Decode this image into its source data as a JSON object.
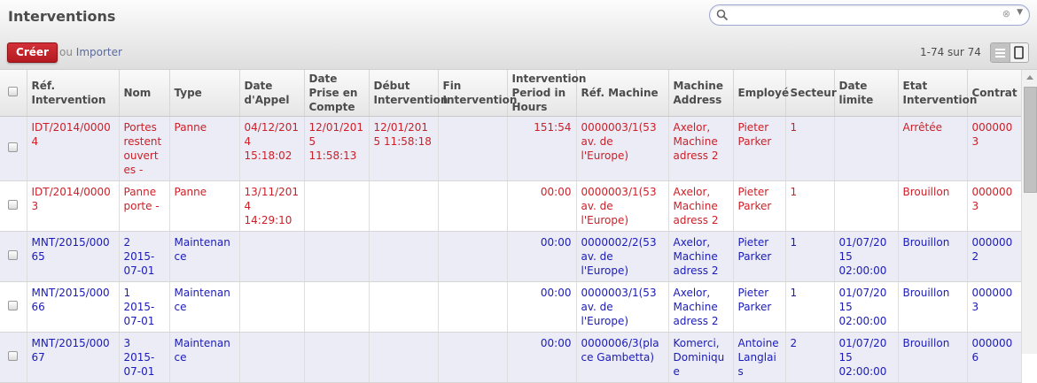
{
  "header": {
    "title": "Interventions",
    "search_placeholder": "",
    "search_clear": "⊗",
    "search_dropdown": "▼"
  },
  "toolbar": {
    "create_label": "Créer",
    "or_label": "ou",
    "import_label": "Importer",
    "pager": "1-74 sur 74"
  },
  "table": {
    "columns": [
      "Réf. Intervention",
      "Nom",
      "Type",
      "Date d'Appel",
      "Date Prise en Compte",
      "Début Intervention",
      "Fin Intervention",
      "Intervention Period in Hours",
      "Réf. Machine",
      "Machine Address",
      "Employé",
      "Secteur",
      "Date limite",
      "Etat Intervention",
      "Contrat"
    ],
    "rows": [
      {
        "color": "red",
        "cells": [
          "IDT/2014/00004",
          "Portes restent ouvertes -",
          "Panne",
          "04/12/2014 15:18:02",
          "12/01/2015 11:58:13",
          "12/01/2015 11:58:18",
          "",
          "151:54",
          "0000003/1(53 av. de l'Europe)",
          "Axelor, Machine adress 2",
          "Pieter Parker",
          "1",
          "",
          "Arrêtée",
          "0000003"
        ]
      },
      {
        "color": "red",
        "cells": [
          "IDT/2014/00003",
          "Panne porte -",
          "Panne",
          "13/11/2014 14:29:10",
          "",
          "",
          "",
          "00:00",
          "0000003/1(53 av. de l'Europe)",
          "Axelor, Machine adress 2",
          "Pieter Parker",
          "1",
          "",
          "Brouillon",
          "0000003"
        ]
      },
      {
        "color": "blue",
        "cells": [
          "MNT/2015/00065",
          "2 2015-07-01",
          "Maintenance",
          "",
          "",
          "",
          "",
          "00:00",
          "0000002/2(53 av. de l'Europe)",
          "Axelor, Machine adress 2",
          "Pieter Parker",
          "1",
          "01/07/2015 02:00:00",
          "Brouillon",
          "0000002"
        ]
      },
      {
        "color": "blue",
        "cells": [
          "MNT/2015/00066",
          "1 2015-07-01",
          "Maintenance",
          "",
          "",
          "",
          "",
          "00:00",
          "0000003/1(53 av. de l'Europe)",
          "Axelor, Machine adress 2",
          "Pieter Parker",
          "1",
          "01/07/2015 02:00:00",
          "Brouillon",
          "0000003"
        ]
      },
      {
        "color": "blue",
        "cells": [
          "MNT/2015/00067",
          "3 2015-07-01",
          "Maintenance",
          "",
          "",
          "",
          "",
          "00:00",
          "0000006/3(place Gambetta)",
          "Komerci, Dominique",
          "Antoine Langlais",
          "2",
          "01/07/2015 02:00:00",
          "Brouillon",
          "0000006"
        ]
      }
    ]
  },
  "colors": {
    "accent_red": "#cc1f27",
    "accent_blue": "#1b1bb8",
    "row_stripe": "#ebecf6",
    "create_button": "#c52a30"
  },
  "icons": {
    "search": "magnifier-icon",
    "list_view": "list-view-icon",
    "kanban_view": "kanban-view-icon"
  }
}
